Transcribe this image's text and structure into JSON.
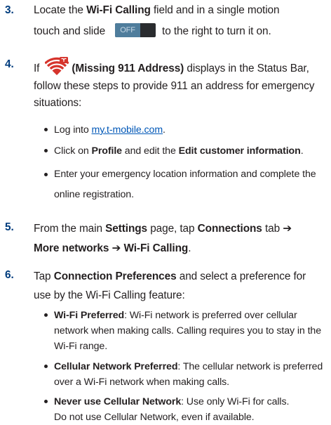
{
  "steps": [
    {
      "num": "3.",
      "line1_a": "Locate the ",
      "line1_b": "Wi-Fi Calling",
      "line1_c": " field and in a single motion",
      "line2_a": "touch and slide",
      "toggle_label": "OFF",
      "line2_b": "to the right to turn it on."
    },
    {
      "num": "4.",
      "a": "If",
      "b": "(Missing 911 Address)",
      "c": " displays in the Status Bar, follow these steps to provide 911 an address for emergency situations:",
      "bullets": [
        {
          "a": "Log into ",
          "link": "my.t-mobile.com",
          "b": "."
        },
        {
          "a": "Click on ",
          "b": "Profile",
          "c": " and edit the ",
          "d": "Edit customer information",
          "e": "."
        },
        {
          "a": "Enter your emergency location information and complete the online registration."
        }
      ]
    },
    {
      "num": "5.",
      "a": "From the main ",
      "b": "Settings",
      "c": " page, tap ",
      "d": "Connections",
      "e": " tab ",
      "f": "➔",
      "g": "More networks ➔ Wi-Fi Calling",
      "h": "."
    },
    {
      "num": "6.",
      "a": "Tap ",
      "b": "Connection Preferences",
      "c": " and select a preference for use by the Wi-Fi Calling feature:",
      "bullets": [
        {
          "b": "Wi-Fi Preferred",
          "a": ": Wi-Fi network is preferred over cellular network when making calls. Calling requires you to stay in the Wi-Fi range."
        },
        {
          "b": "Cellular Network Preferred",
          "a": ": The cellular network is preferred over a Wi-Fi network when making calls."
        },
        {
          "b": "Never use Cellular Network",
          "a": ": Use only Wi-Fi for calls.",
          "c": "Do not use Cellular Network, even if available."
        }
      ]
    }
  ],
  "icons": {
    "missing_911": "wifi-calling-error-icon",
    "toggle": "toggle-switch-icon"
  },
  "colors": {
    "step_number": "#003c7d",
    "link": "#0057b7",
    "icon": "#d6342c"
  }
}
